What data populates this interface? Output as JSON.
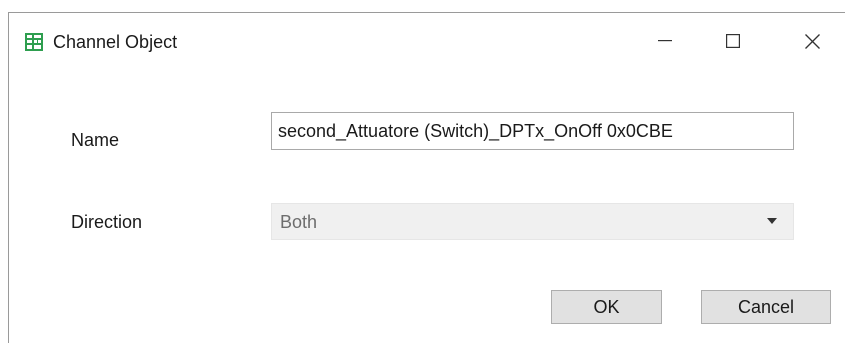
{
  "window": {
    "title": "Channel Object",
    "icon": "grid-app-icon",
    "controls": [
      "minimize-icon",
      "maximize-icon",
      "close-icon"
    ]
  },
  "form": {
    "name_label": "Name",
    "name_value": "second_Attuatore (Switch)_DPTx_OnOff 0x0CBE",
    "direction_label": "Direction",
    "direction_value": "Both"
  },
  "buttons": {
    "ok_label": "OK",
    "cancel_label": "Cancel"
  },
  "colors": {
    "app_icon": "#2e9e4f",
    "select_background": "#f0f0f0",
    "button_background": "#e1e1e1"
  }
}
